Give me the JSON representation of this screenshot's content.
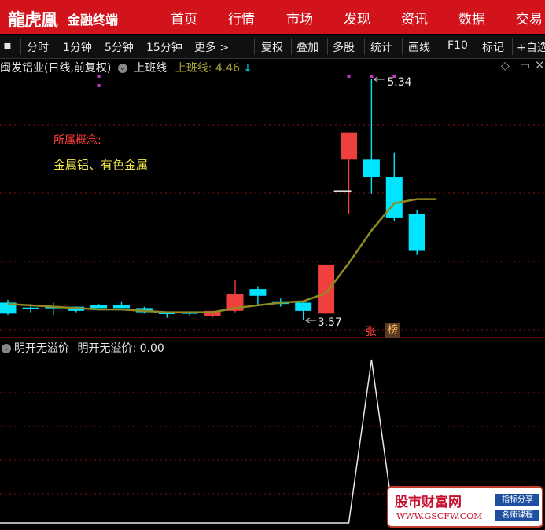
{
  "header": {
    "logo": "龍虎鳯",
    "app_name": "金融终端",
    "nav": [
      "首页",
      "行情",
      "市场",
      "发现",
      "资讯",
      "数据",
      "交易"
    ]
  },
  "toolbar": {
    "periods": [
      "分时",
      "1分钟",
      "5分钟",
      "15分钟",
      "更多 >"
    ],
    "actions": [
      "复权",
      "叠加",
      "多股",
      "统计",
      "画线",
      "F10",
      "标记",
      "+自选"
    ]
  },
  "main_chart": {
    "stock_title": "闽发铝业(日线,前复权)",
    "indicator_name": "上班线",
    "indicator_label": "上班线: 4.46",
    "concept_label": "所属概念:",
    "concept_value": "金属铝、有色金属",
    "high_label": "5.34",
    "low_label": "3.57",
    "badge_zhang": "张",
    "badge_bang": "榜"
  },
  "sub_chart": {
    "title": "明开无溢价",
    "value_label": "明开无溢价: 0.00"
  },
  "watermark": {
    "title": "股市财富网",
    "url": "WWW.GSCFW.COM",
    "tag1": "指标分享",
    "tag2": "名师课程"
  },
  "colors": {
    "up": "#f0403d",
    "down": "#00e5ff",
    "ma": "#8f8a23",
    "accent": "#d2131b"
  },
  "chart_data": {
    "type": "candlestick",
    "candles": [
      {
        "o": 3.7,
        "c": 3.62,
        "h": 3.72,
        "l": 3.61
      },
      {
        "o": 3.66,
        "c": 3.66,
        "h": 3.69,
        "l": 3.63
      },
      {
        "o": 3.67,
        "c": 3.66,
        "h": 3.7,
        "l": 3.61
      },
      {
        "o": 3.67,
        "c": 3.64,
        "h": 3.67,
        "l": 3.63
      },
      {
        "o": 3.68,
        "c": 3.66,
        "h": 3.69,
        "l": 3.66
      },
      {
        "o": 3.68,
        "c": 3.66,
        "h": 3.71,
        "l": 3.66
      },
      {
        "o": 3.66,
        "c": 3.63,
        "h": 3.67,
        "l": 3.62
      },
      {
        "o": 3.62,
        "c": 3.62,
        "h": 3.63,
        "l": 3.59
      },
      {
        "o": 3.63,
        "c": 3.62,
        "h": 3.63,
        "l": 3.6
      },
      {
        "o": 3.6,
        "c": 3.64,
        "h": 3.64,
        "l": 3.59
      },
      {
        "o": 3.64,
        "c": 3.76,
        "h": 3.87,
        "l": 3.63
      },
      {
        "o": 3.8,
        "c": 3.75,
        "h": 3.82,
        "l": 3.68
      },
      {
        "o": 3.71,
        "c": 3.69,
        "h": 3.73,
        "l": 3.67
      },
      {
        "o": 3.7,
        "c": 3.64,
        "h": 3.71,
        "l": 3.57
      },
      {
        "o": 3.62,
        "c": 3.98,
        "h": 3.98,
        "l": 3.62
      },
      {
        "o": 4.75,
        "c": 4.95,
        "h": 4.95,
        "l": 4.35
      },
      {
        "o": 4.75,
        "c": 4.62,
        "h": 5.34,
        "l": 4.5
      },
      {
        "o": 4.62,
        "c": 4.32,
        "h": 4.8,
        "l": 4.3
      },
      {
        "o": 4.35,
        "c": 4.08,
        "h": 4.38,
        "l": 4.05
      }
    ],
    "limit_marker": {
      "index": 14,
      "value": 4.52
    },
    "ma": [
      3.69,
      3.68,
      3.67,
      3.66,
      3.65,
      3.65,
      3.64,
      3.63,
      3.63,
      3.63,
      3.66,
      3.68,
      3.7,
      3.71,
      3.77,
      3.99,
      4.23,
      4.43,
      4.46
    ],
    "high_point": 5.34,
    "low_point": 3.57,
    "sub_values": [
      0,
      0,
      0,
      0,
      0,
      0,
      0,
      0,
      0,
      0,
      0,
      0,
      0,
      0,
      0,
      0,
      1,
      0,
      0,
      0
    ]
  }
}
